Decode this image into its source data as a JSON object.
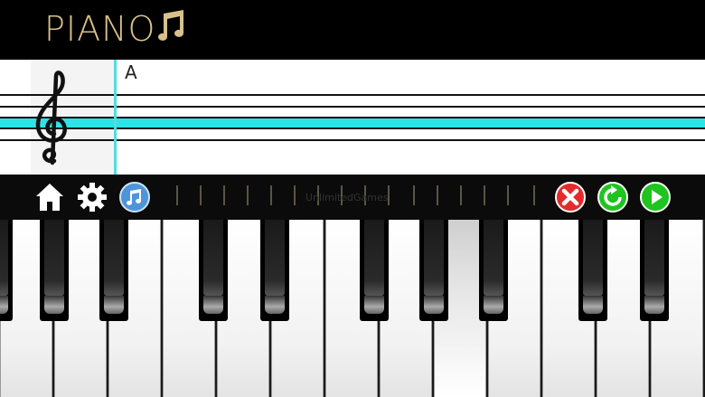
{
  "app": {
    "title": "PIANO",
    "title_icon": "music-note-icon"
  },
  "staff": {
    "note_name": "A",
    "clef": "treble-clef-icon",
    "highlight_color": "#2ee3e8"
  },
  "toolbar": {
    "watermark": "UnlimitedGames",
    "left_buttons": [
      "home-icon",
      "gear-icon",
      "music-note-icon"
    ],
    "right_buttons": [
      "close-icon",
      "refresh-icon",
      "play-icon"
    ]
  },
  "keyboard": {
    "pressed_key": 8
  },
  "colors": {
    "title": "#d8c18b",
    "accent": "#2ee3e8",
    "close": "#e42b2b",
    "refresh": "#1fc41f",
    "play": "#1fc41f"
  }
}
